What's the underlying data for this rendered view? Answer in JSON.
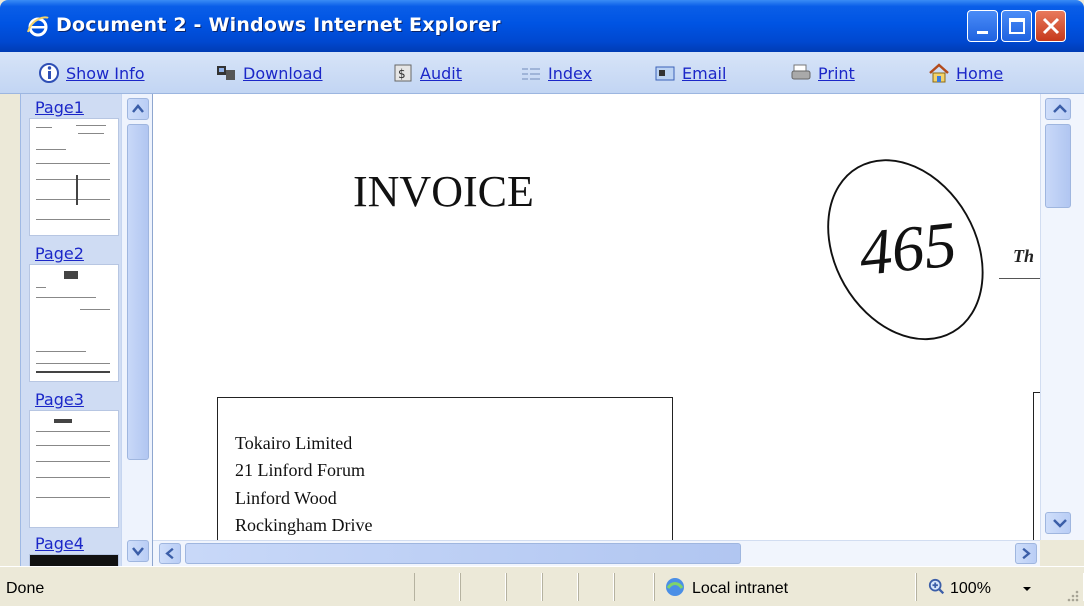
{
  "window": {
    "title": "Document 2 - Windows Internet Explorer"
  },
  "toolbar": {
    "items": [
      {
        "label": "Show Info",
        "icon": "info-icon"
      },
      {
        "label": "Download",
        "icon": "download-icon"
      },
      {
        "label": "Audit",
        "icon": "audit-icon"
      },
      {
        "label": "Index",
        "icon": "index-icon"
      },
      {
        "label": "Email",
        "icon": "email-icon"
      },
      {
        "label": "Print",
        "icon": "print-icon"
      },
      {
        "label": "Home",
        "icon": "home-icon"
      }
    ]
  },
  "thumbnails": {
    "pages": [
      "Page1",
      "Page2",
      "Page3",
      "Page4"
    ]
  },
  "document": {
    "heading": "INVOICE",
    "stamp": "465",
    "partial_text": "Th",
    "address": [
      "Tokairo Limited",
      "21 Linford Forum",
      "Linford Wood",
      "Rockingham Drive"
    ]
  },
  "status": {
    "state": "Done",
    "zone": "Local intranet",
    "zoom": "100%"
  },
  "colors": {
    "titlebar": "#0054e3",
    "link": "#1b27c8",
    "statusbar": "#ece9d8"
  }
}
